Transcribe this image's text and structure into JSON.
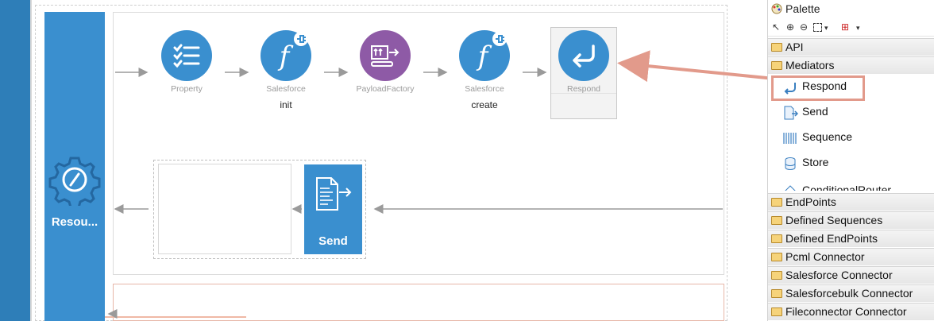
{
  "canvas": {
    "resource_label": "Resou...",
    "in_sequence": [
      {
        "label": "Property",
        "sublabel": "",
        "icon": "checklist-icon",
        "color": "#3a8fcf"
      },
      {
        "label": "Salesforce",
        "sublabel": "init",
        "icon": "function-connector-icon",
        "color": "#3a8fcf"
      },
      {
        "label": "PayloadFactory",
        "sublabel": "",
        "icon": "payload-factory-icon",
        "color": "#8e5aa6"
      },
      {
        "label": "Salesforce",
        "sublabel": "create",
        "icon": "function-connector-icon",
        "color": "#3a8fcf"
      },
      {
        "label": "Respond",
        "sublabel": "",
        "icon": "respond-arrow-icon",
        "color": "#3a8fcf"
      }
    ],
    "out_sequence": {
      "send_label": "Send",
      "icon": "send-document-icon"
    },
    "accent_color": "#3a8fcf",
    "highlight_color": "#e29a8b"
  },
  "palette": {
    "title": "Palette",
    "toolbar_icons": [
      "select-arrow-icon",
      "zoom-in-icon",
      "zoom-out-icon",
      "marquee-icon",
      "dropdown-icon",
      "connection-icon",
      "dropdown-icon"
    ],
    "drawers_top": [
      {
        "label": "API"
      },
      {
        "label": "Mediators"
      }
    ],
    "mediator_items": [
      {
        "label": "Respond",
        "icon": "respond-icon"
      },
      {
        "label": "Send",
        "icon": "send-icon"
      },
      {
        "label": "Sequence",
        "icon": "sequence-icon"
      },
      {
        "label": "Store",
        "icon": "store-icon"
      },
      {
        "label": "ConditionalRouter",
        "icon": "conditional-router-icon"
      }
    ],
    "drawers_bottom": [
      {
        "label": "EndPoints"
      },
      {
        "label": "Defined Sequences"
      },
      {
        "label": "Defined EndPoints"
      },
      {
        "label": "Pcml Connector"
      },
      {
        "label": "Salesforce Connector"
      },
      {
        "label": "Salesforcebulk Connector"
      },
      {
        "label": "Fileconnector Connector"
      }
    ]
  }
}
